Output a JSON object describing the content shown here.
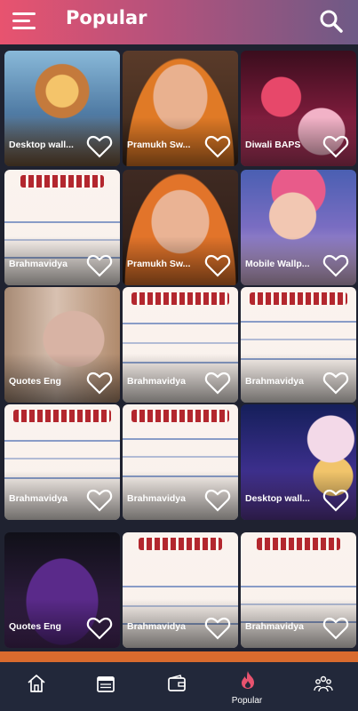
{
  "header": {
    "title": "Popular"
  },
  "cards": [
    {
      "label": "Desktop wall..."
    },
    {
      "label": "Pramukh Sw..."
    },
    {
      "label": "Diwali BAPS"
    },
    {
      "label": "Brahmavidya"
    },
    {
      "label": "Pramukh Sw..."
    },
    {
      "label": "Mobile Wallp..."
    },
    {
      "label": "Quotes Eng"
    },
    {
      "label": "Brahmavidya"
    },
    {
      "label": "Brahmavidya"
    },
    {
      "label": "Brahmavidya"
    },
    {
      "label": "Brahmavidya"
    },
    {
      "label": "Desktop wall..."
    },
    {
      "label": "Quotes Eng"
    },
    {
      "label": "Brahmavidya"
    },
    {
      "label": "Brahmavidya"
    }
  ],
  "bottom_nav": {
    "items": [
      {
        "icon": "home-icon",
        "label": ""
      },
      {
        "icon": "calendar-icon",
        "label": ""
      },
      {
        "icon": "wallet-icon",
        "label": ""
      },
      {
        "icon": "flame-icon",
        "label": "Popular"
      },
      {
        "icon": "people-icon",
        "label": ""
      }
    ]
  },
  "colors": {
    "header_start": "#e8536f",
    "header_end": "#6e5a86",
    "nav_bg": "#22283a",
    "page_bg": "#1f2230"
  }
}
